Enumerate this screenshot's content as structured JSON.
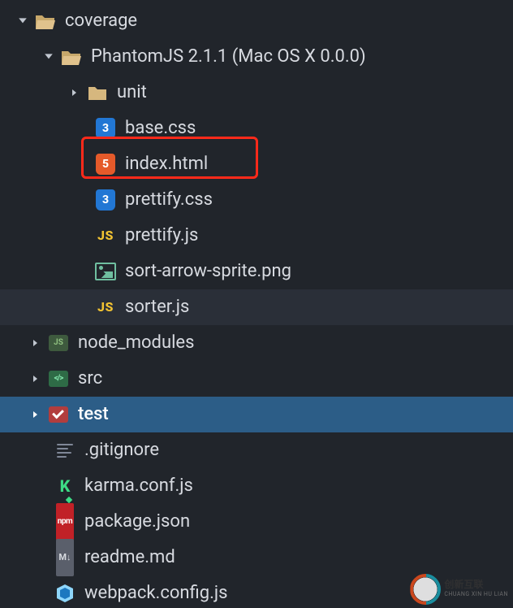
{
  "tree": {
    "coverage": {
      "label": "coverage",
      "phantom": {
        "label": "PhantomJS 2.1.1 (Mac OS X 0.0.0)",
        "unit": {
          "label": "unit"
        },
        "base_css": {
          "label": "base.css"
        },
        "index_html": {
          "label": "index.html"
        },
        "prettify_css": {
          "label": "prettify.css"
        },
        "prettify_js": {
          "label": "prettify.js"
        },
        "sort_arrow": {
          "label": "sort-arrow-sprite.png"
        },
        "sorter_js": {
          "label": "sorter.js"
        }
      }
    },
    "node_modules": {
      "label": "node_modules"
    },
    "src": {
      "label": "src"
    },
    "test": {
      "label": "test"
    },
    "gitignore": {
      "label": ".gitignore"
    },
    "karma": {
      "label": "karma.conf.js"
    },
    "package": {
      "label": "package.json"
    },
    "readme": {
      "label": "readme.md"
    },
    "webpack": {
      "label": "webpack.config.js"
    }
  },
  "watermark": {
    "cn": "创新互联",
    "en": "CHUANG XIN HU LIAN"
  }
}
